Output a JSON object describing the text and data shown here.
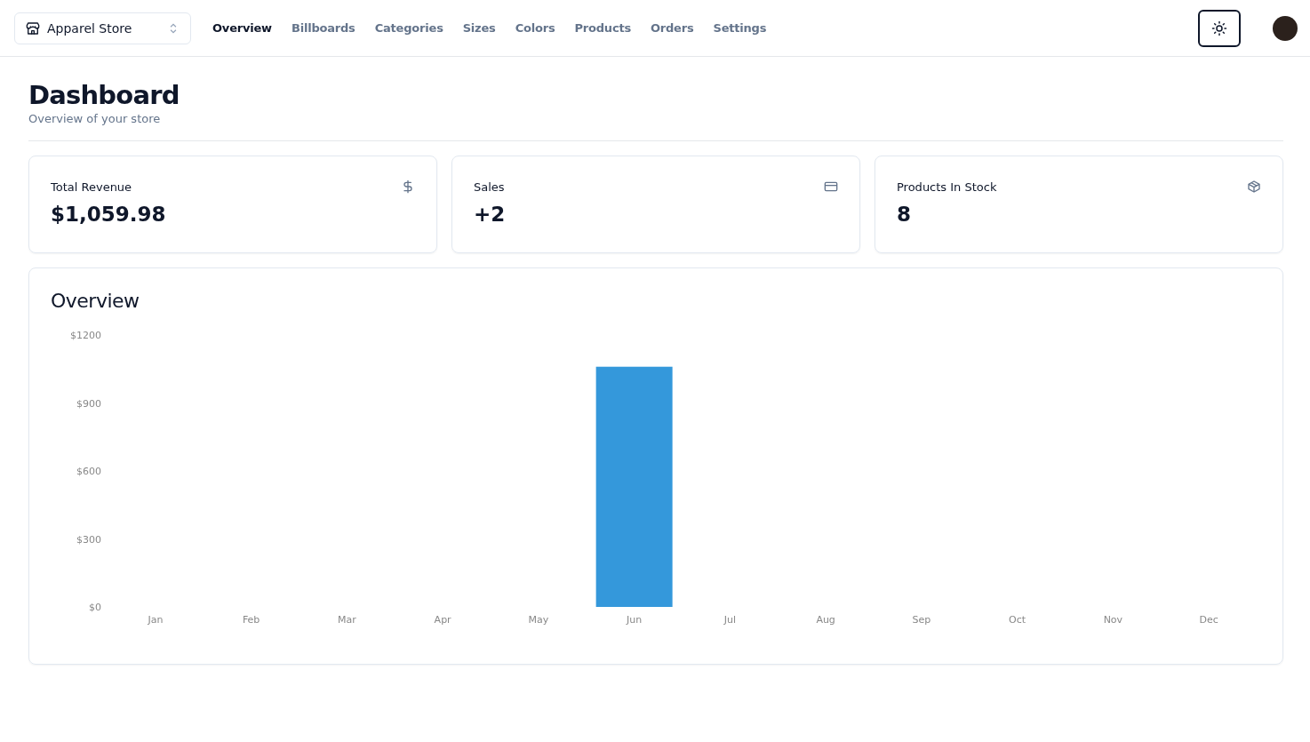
{
  "store_switcher": {
    "label": "Apparel Store"
  },
  "nav": [
    {
      "label": "Overview",
      "selected": true
    },
    {
      "label": "Billboards",
      "selected": false
    },
    {
      "label": "Categories",
      "selected": false
    },
    {
      "label": "Sizes",
      "selected": false
    },
    {
      "label": "Colors",
      "selected": false
    },
    {
      "label": "Products",
      "selected": false
    },
    {
      "label": "Orders",
      "selected": false
    },
    {
      "label": "Settings",
      "selected": false
    }
  ],
  "page": {
    "title": "Dashboard",
    "subtitle": "Overview of your store"
  },
  "stats": [
    {
      "kind": "money",
      "label": "Total Revenue",
      "value": "$1,059.98"
    },
    {
      "kind": "card",
      "label": "Sales",
      "value": "+2"
    },
    {
      "kind": "package",
      "label": "Products In Stock",
      "value": "8"
    }
  ],
  "overview": {
    "title": "Overview",
    "chart_data": {
      "type": "bar",
      "categories": [
        "Jan",
        "Feb",
        "Mar",
        "Apr",
        "May",
        "Jun",
        "Jul",
        "Aug",
        "Sep",
        "Oct",
        "Nov",
        "Dec"
      ],
      "values": [
        0,
        0,
        0,
        0,
        0,
        1060,
        0,
        0,
        0,
        0,
        0,
        0
      ],
      "ylim": [
        0,
        1200
      ],
      "yticks": [
        {
          "value": 0,
          "label": "$0"
        },
        {
          "value": 300,
          "label": "$300"
        },
        {
          "value": 600,
          "label": "$600"
        },
        {
          "value": 900,
          "label": "$900"
        },
        {
          "value": 1200,
          "label": "$1200"
        }
      ]
    }
  }
}
